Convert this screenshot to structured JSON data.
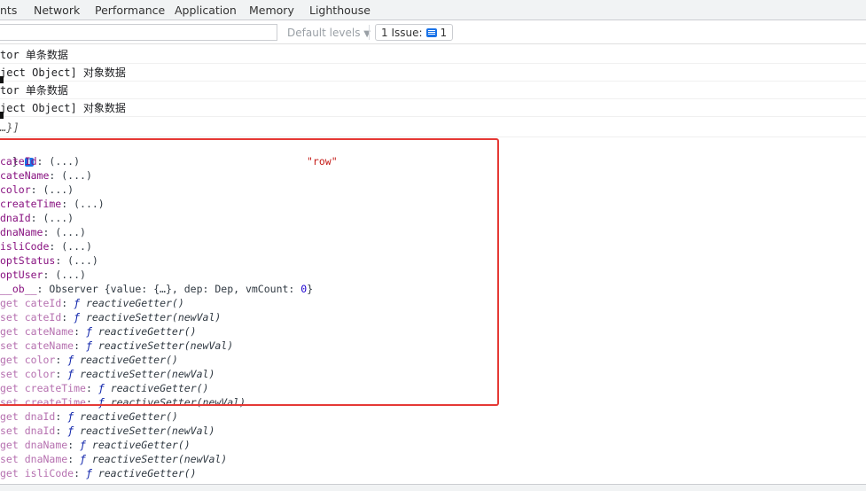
{
  "tabs": [
    "nts",
    "Network",
    "Performance",
    "Application",
    "Memory",
    "Lighthouse"
  ],
  "toolbar": {
    "levels_label": "Default levels",
    "levels_arrow": "▼",
    "issues_label": "1 Issue:",
    "issues_count": "1"
  },
  "logs": [
    {
      "text": "tor ",
      "cjk": "单条数据"
    },
    {
      "text": "ject Object] ",
      "cjk": "对象数据"
    },
    {
      "text": "tor ",
      "cjk": "单条数据"
    },
    {
      "text": "ject Object] ",
      "cjk": "对象数据"
    },
    {
      "text": "…}]",
      "cjk": ""
    }
  ],
  "object": {
    "header_brace": "}",
    "info_glyph": "i",
    "row_string": "\"row\"",
    "lazy_props": [
      {
        "key": "cateId",
        "value": "(...)"
      },
      {
        "key": "cateName",
        "value": "(...)"
      },
      {
        "key": "color",
        "value": "(...)"
      },
      {
        "key": "createTime",
        "value": "(...)"
      },
      {
        "key": "dnaId",
        "value": "(...)"
      },
      {
        "key": "dnaName",
        "value": "(...)"
      },
      {
        "key": "isliCode",
        "value": "(...)"
      },
      {
        "key": "optStatus",
        "value": "(...)"
      },
      {
        "key": "optUser",
        "value": "(...)"
      }
    ],
    "ob_key": "__ob__",
    "ob_value": "Observer {value: {…}, dep: Dep, vmCount: ",
    "ob_count": "0",
    "ob_close": "}",
    "accessors": [
      {
        "kind": "get",
        "key": "cateId",
        "fn": "reactiveGetter()"
      },
      {
        "kind": "set",
        "key": "cateId",
        "fn": "reactiveSetter(newVal)"
      },
      {
        "kind": "get",
        "key": "cateName",
        "fn": "reactiveGetter()"
      },
      {
        "kind": "set",
        "key": "cateName",
        "fn": "reactiveSetter(newVal)"
      },
      {
        "kind": "get",
        "key": "color",
        "fn": "reactiveGetter()"
      },
      {
        "kind": "set",
        "key": "color",
        "fn": "reactiveSetter(newVal)"
      },
      {
        "kind": "get",
        "key": "createTime",
        "fn": "reactiveGetter()"
      },
      {
        "kind": "set",
        "key": "createTime",
        "fn": "reactiveSetter(newVal)"
      },
      {
        "kind": "get",
        "key": "dnaId",
        "fn": "reactiveGetter()"
      },
      {
        "kind": "set",
        "key": "dnaId",
        "fn": "reactiveSetter(newVal)"
      },
      {
        "kind": "get",
        "key": "dnaName",
        "fn": "reactiveGetter()"
      },
      {
        "kind": "set",
        "key": "dnaName",
        "fn": "reactiveSetter(newVal)"
      },
      {
        "kind": "get",
        "key": "isliCode",
        "fn": "reactiveGetter()"
      }
    ]
  },
  "colors": {
    "highlight": "#e53935",
    "key": "#881280",
    "string": "#c41a16",
    "number": "#1c00cf",
    "function": "#0d22aa"
  }
}
